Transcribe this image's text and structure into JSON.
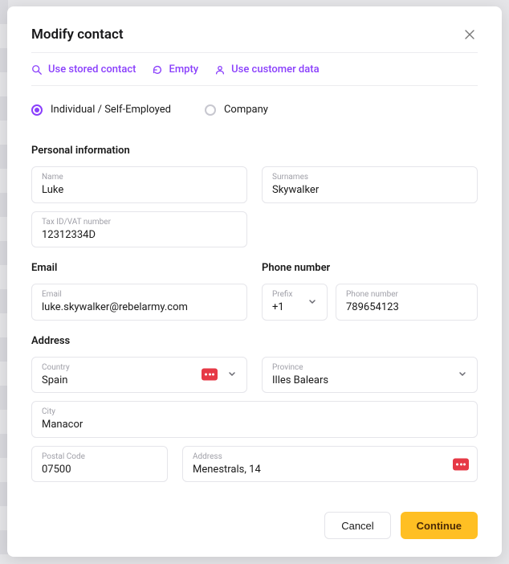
{
  "modal": {
    "title": "Modify contact"
  },
  "actions": {
    "use_stored": "Use stored contact",
    "empty": "Empty",
    "use_customer": "Use customer data"
  },
  "contact_type": {
    "individual": "Individual / Self-Employed",
    "company": "Company"
  },
  "sections": {
    "personal": "Personal information",
    "email": "Email",
    "phone": "Phone number",
    "address": "Address"
  },
  "fields": {
    "name": {
      "label": "Name",
      "value": "Luke"
    },
    "surnames": {
      "label": "Surnames",
      "value": "Skywalker"
    },
    "tax_id": {
      "label": "Tax ID/VAT number",
      "value": "12312334D"
    },
    "email": {
      "label": "Email",
      "value": "luke.skywalker@rebelarmy.com"
    },
    "prefix": {
      "label": "Prefix",
      "value": "+1"
    },
    "phone": {
      "label": "Phone number",
      "value": "789654123"
    },
    "country": {
      "label": "Country",
      "value": "Spain"
    },
    "province": {
      "label": "Province",
      "value": "Illes Balears"
    },
    "city": {
      "label": "City",
      "value": "Manacor"
    },
    "postal": {
      "label": "Postal Code",
      "value": "07500"
    },
    "address": {
      "label": "Address",
      "value": "Menestrals, 14"
    }
  },
  "buttons": {
    "cancel": "Cancel",
    "continue": "Continue"
  }
}
